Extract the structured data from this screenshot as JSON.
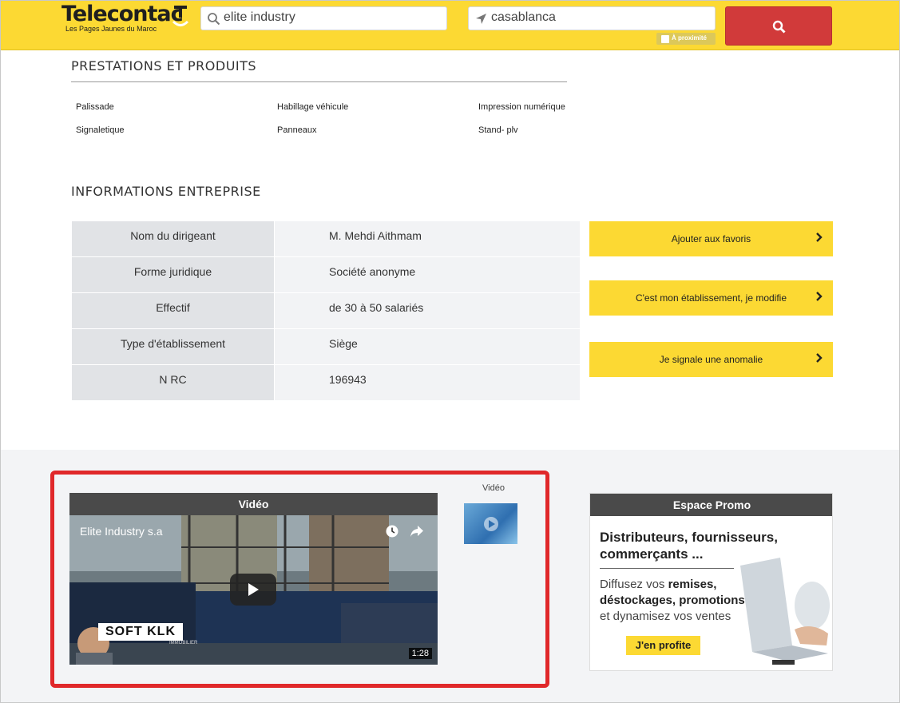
{
  "header": {
    "logo_text": "Telecontac",
    "logo_subtitle": "Les Pages Jaunes du Maroc",
    "what_value": "elite industry",
    "where_value": "casablanca",
    "proximity_label": "À proximité",
    "colors": {
      "yellow": "#fcd933",
      "search_red": "#d13a3a"
    }
  },
  "products": {
    "title": "PRESTATIONS ET PRODUITS",
    "items": [
      "Palissade",
      "Habillage véhicule",
      "Impression numérique",
      "Signaletique",
      "Panneaux",
      "Stand- plv"
    ]
  },
  "company": {
    "title": "INFORMATIONS ENTREPRISE",
    "rows": [
      {
        "label": "Nom du dirigeant",
        "value": "M. Mehdi Aithmam"
      },
      {
        "label": "Forme juridique",
        "value": "Société anonyme"
      },
      {
        "label": "Effectif",
        "value": "de 30 à 50 salariés"
      },
      {
        "label": "Type d'établissement",
        "value": "Siège"
      },
      {
        "label": "N RC",
        "value": "196943"
      }
    ]
  },
  "actions": {
    "favorites": "Ajouter aux favoris",
    "claim": "C'est mon établissement, je modifie",
    "report": "Je signale une anomalie"
  },
  "video": {
    "header": "Vidéo",
    "title": "Elite Industry s.a",
    "duration": "1:28",
    "thumb_label": "Vidéo",
    "watermark_brand": "SOFT KLK",
    "watermark_sub": "IMMOBILIER"
  },
  "promo": {
    "header": "Espace Promo",
    "headline": "Distributeurs, fournisseurs, commerçants ...",
    "body_1": "Diffusez vos ",
    "body_b1": "remises,",
    "body_b2": "déstockages, promotions",
    "body_2": "et dynamisez vos ventes",
    "cta": "J'en profite"
  }
}
